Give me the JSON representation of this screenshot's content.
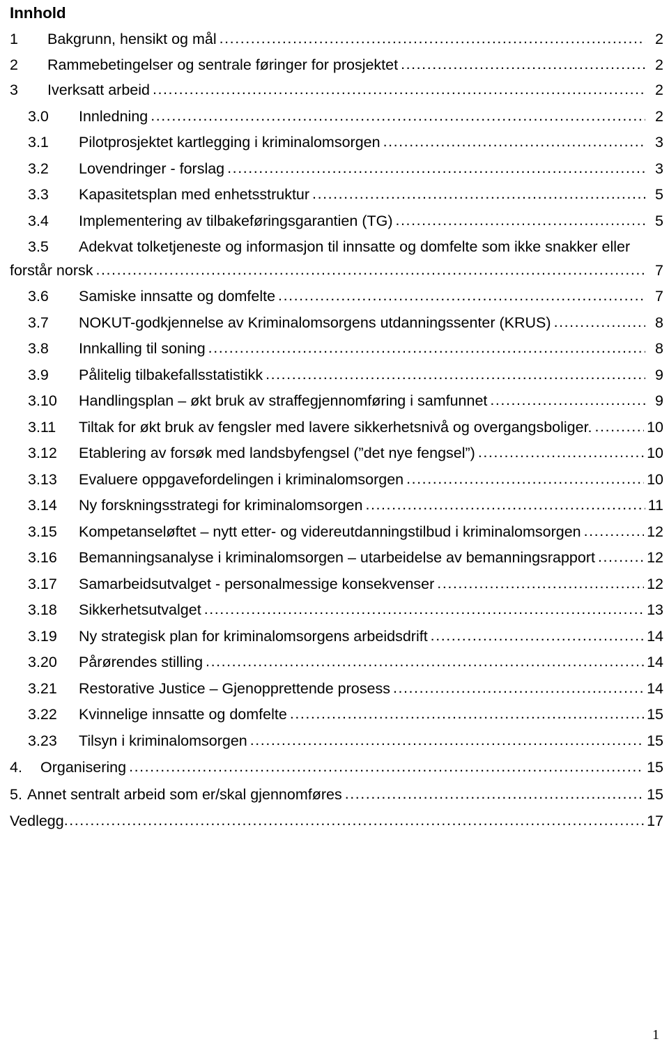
{
  "document": {
    "heading": "Innhold",
    "page_footer_number": "1"
  },
  "toc": {
    "leader_char": ".",
    "entries": [
      {
        "level": 1,
        "number": "1",
        "title": "Bakgrunn, hensikt og mål",
        "page": "2"
      },
      {
        "level": 1,
        "number": "2",
        "title": "Rammebetingelser og sentrale føringer for prosjektet",
        "page": "2"
      },
      {
        "level": 1,
        "number": "3",
        "title": "Iverksatt arbeid",
        "page": "2"
      },
      {
        "level": 2,
        "number": "3.0",
        "title": "Innledning",
        "page": "2"
      },
      {
        "level": 2,
        "number": "3.1",
        "title": "Pilotprosjektet kartlegging i kriminalomsorgen",
        "page": "3"
      },
      {
        "level": 2,
        "number": "3.2",
        "title": "Lovendringer - forslag",
        "page": "3"
      },
      {
        "level": 2,
        "number": "3.3",
        "title": "Kapasitetsplan med enhetsstruktur",
        "page": "5"
      },
      {
        "level": 2,
        "number": "3.4",
        "title": "Implementering av tilbakeføringsgarantien (TG)",
        "page": "5"
      },
      {
        "level": 2,
        "number": "3.5",
        "title": "Adekvat tolketjeneste og informasjon til innsatte og domfelte som ikke snakker eller",
        "title_line2": "forstår norsk",
        "page": "7",
        "wrapped": true
      },
      {
        "level": 2,
        "number": "3.6",
        "title": "Samiske innsatte og domfelte",
        "page": "7"
      },
      {
        "level": 2,
        "number": "3.7",
        "title": "NOKUT-godkjennelse av Kriminalomsorgens utdanningssenter (KRUS)",
        "page": "8"
      },
      {
        "level": 2,
        "number": "3.8",
        "title": "Innkalling til soning",
        "page": "8"
      },
      {
        "level": 2,
        "number": "3.9",
        "title": "Pålitelig tilbakefallsstatistikk",
        "page": "9"
      },
      {
        "level": 2,
        "number": "3.10",
        "title": "Handlingsplan – økt bruk av straffegjennomføring i samfunnet",
        "page": "9"
      },
      {
        "level": 2,
        "number": "3.11",
        "title": "Tiltak for økt bruk av fengsler med lavere sikkerhetsnivå og overgangsboliger.",
        "page": "10"
      },
      {
        "level": 2,
        "number": "3.12",
        "title": "Etablering av forsøk med landsbyfengsel (”det nye fengsel”)",
        "page": "10"
      },
      {
        "level": 2,
        "number": "3.13",
        "title": "Evaluere oppgavefordelingen i kriminalomsorgen",
        "page": "10"
      },
      {
        "level": 2,
        "number": "3.14",
        "title": "Ny forskningsstrategi for kriminalomsorgen",
        "page": "11"
      },
      {
        "level": 2,
        "number": "3.15",
        "title": "Kompetanseløftet – nytt etter- og videreutdanningstilbud i kriminalomsorgen",
        "page": "12"
      },
      {
        "level": 2,
        "number": "3.16",
        "title": "Bemanningsanalyse i kriminalomsorgen – utarbeidelse av bemanningsrapport",
        "page": "12"
      },
      {
        "level": 2,
        "number": "3.17",
        "title": "Samarbeidsutvalget - personalmessige konsekvenser",
        "page": "12"
      },
      {
        "level": 2,
        "number": "3.18",
        "title": "Sikkerhetsutvalget",
        "page": "13"
      },
      {
        "level": 2,
        "number": "3.19",
        "title": "Ny strategisk plan for kriminalomsorgens arbeidsdrift",
        "page": "14"
      },
      {
        "level": 2,
        "number": "3.20",
        "title": "Pårørendes stilling",
        "page": "14"
      },
      {
        "level": 2,
        "number": "3.21",
        "title": "Restorative Justice – Gjenopprettende prosess",
        "page": "14"
      },
      {
        "level": 2,
        "number": "3.22",
        "title": "Kvinnelige innsatte og domfelte",
        "page": "15"
      },
      {
        "level": 2,
        "number": "3.23",
        "title": "Tilsyn i kriminalomsorgen",
        "page": "15"
      },
      {
        "level": 1,
        "number": "4.",
        "title": "Organisering",
        "page": "15"
      },
      {
        "level": 1,
        "number": "5.",
        "title": "Annet sentralt arbeid som er/skal gjennomføres",
        "page": "15"
      },
      {
        "level": 1,
        "number": "",
        "title": "Vedlegg",
        "page": "17"
      }
    ]
  }
}
